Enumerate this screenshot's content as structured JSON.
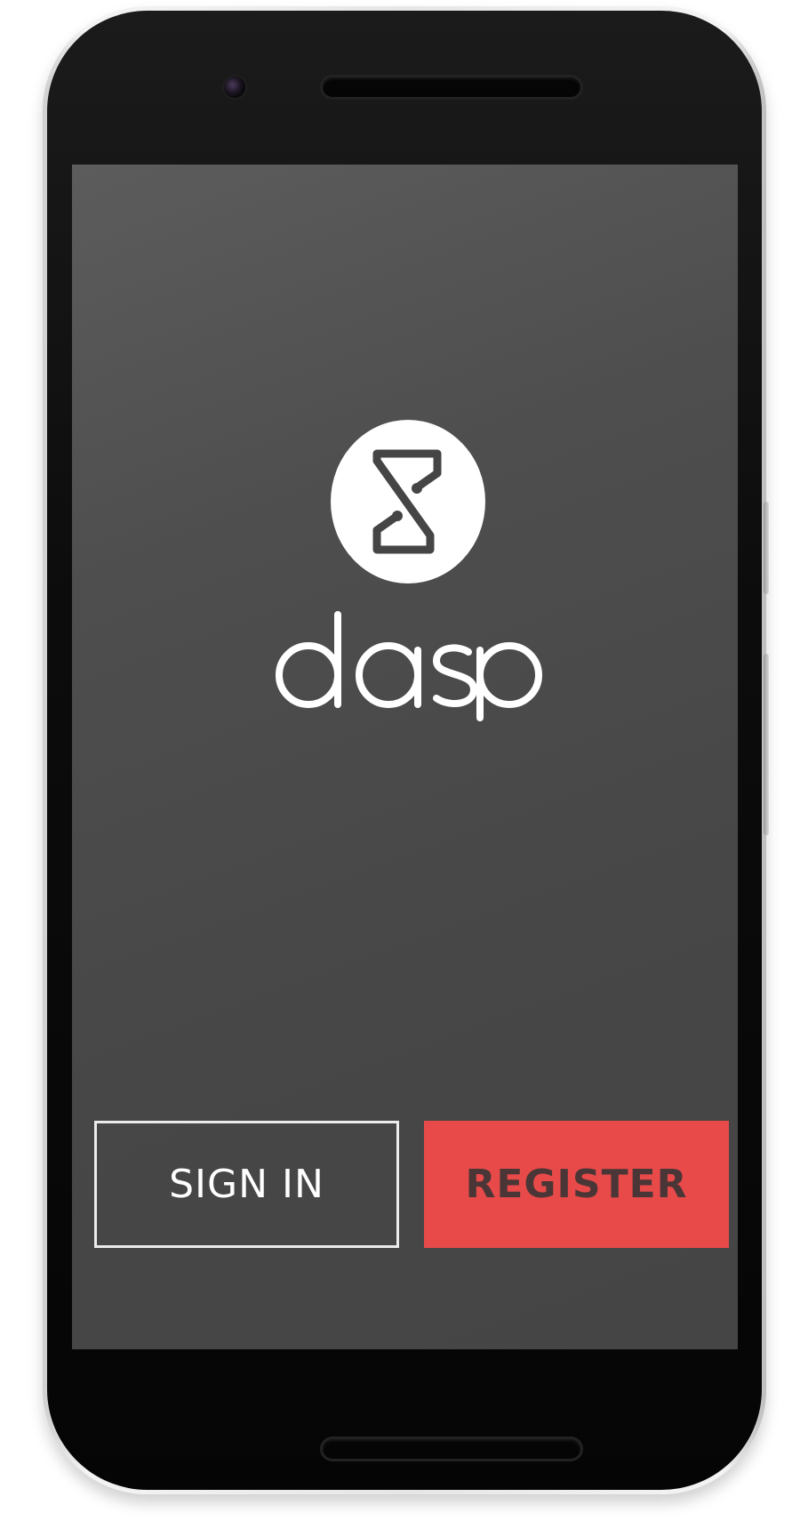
{
  "app": {
    "brand_name": "dasp",
    "logo_icon": "hourglass-s-icon"
  },
  "auth": {
    "sign_in_label": "SIGN IN",
    "register_label": "REGISTER"
  },
  "colors": {
    "screen_background": "#474747",
    "register_accent": "#e84a4a",
    "register_text": "#4a3636",
    "logo_white": "#ffffff"
  }
}
